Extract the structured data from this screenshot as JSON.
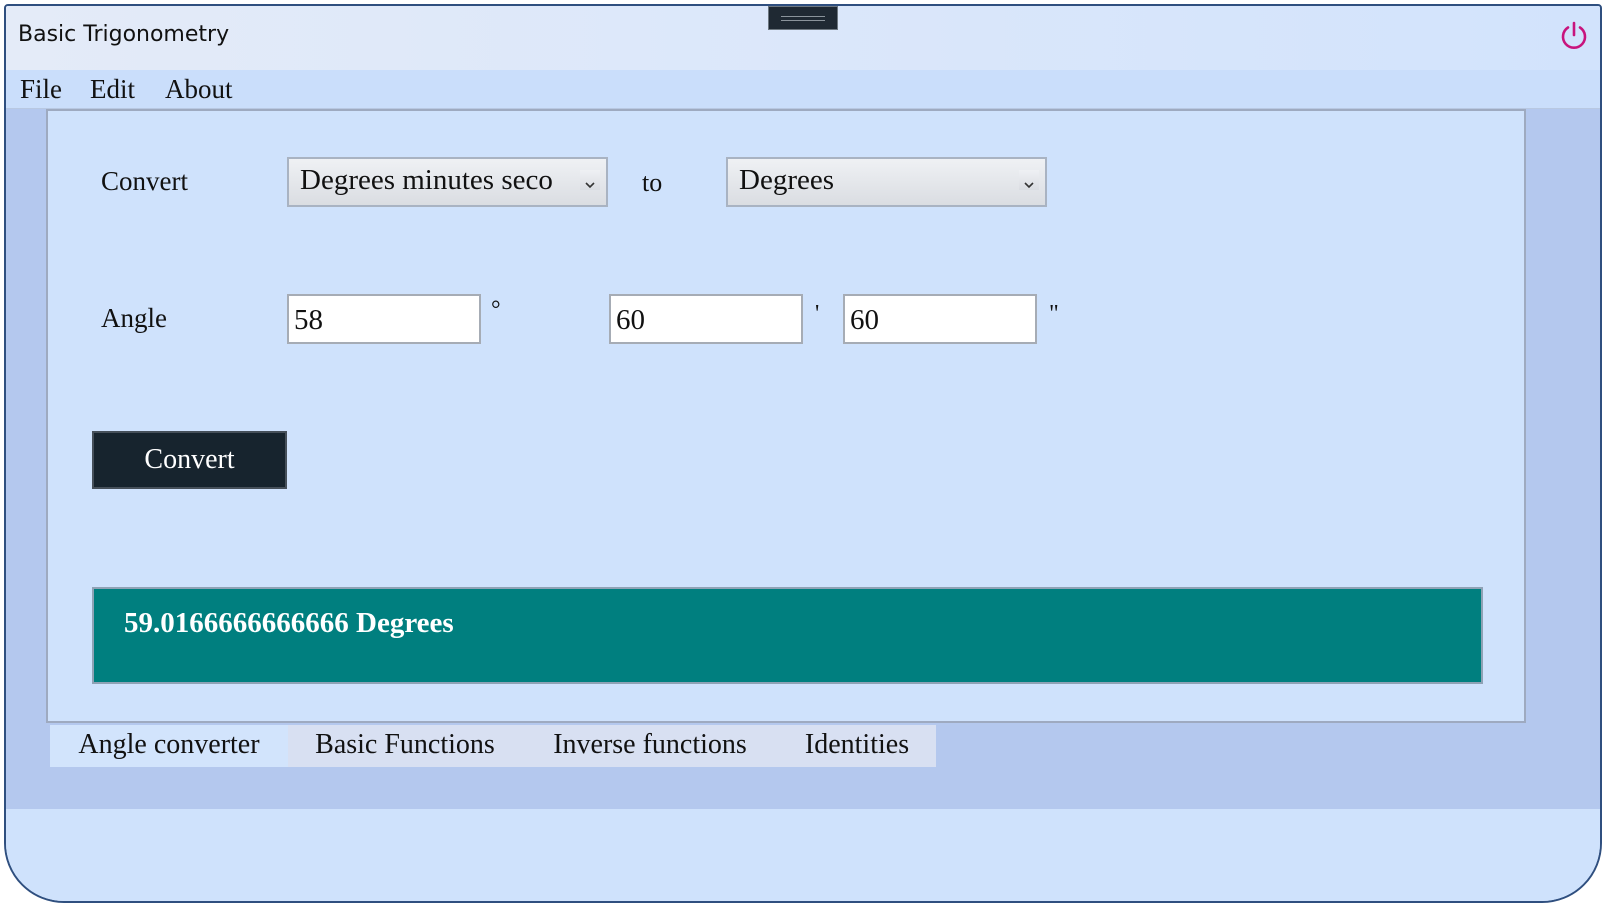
{
  "window": {
    "title": "Basic Trigonometry"
  },
  "menu": {
    "items": [
      "File",
      "Edit",
      "About"
    ]
  },
  "converter": {
    "convert_label": "Convert",
    "from_unit": "Degrees minutes seco",
    "to_label": "to",
    "to_unit": "Degrees",
    "angle_label": "Angle",
    "degrees_value": "58",
    "degrees_symbol": "°",
    "minutes_value": "60",
    "minutes_symbol": "'",
    "seconds_value": "60",
    "seconds_symbol": "\"",
    "convert_button": "Convert",
    "result": "59.0166666666666 Degrees"
  },
  "tabs": [
    "Angle converter",
    "Basic Functions",
    "Inverse functions",
    "Identities"
  ],
  "colors": {
    "window_bg": "#cfe2fc",
    "result_bg": "#007f7f",
    "button_bg": "#17242e",
    "power_icon": "#c8147d"
  },
  "icons": {
    "power": "power-icon",
    "dropdown": "chevron-down-icon"
  }
}
